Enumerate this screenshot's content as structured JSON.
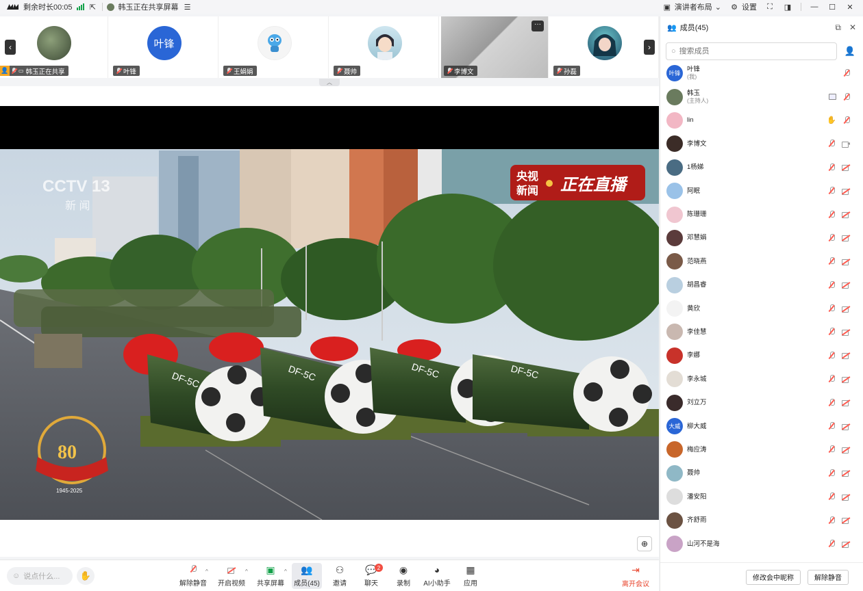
{
  "titlebar": {
    "remaining": "剩余时长00:05",
    "share_status": "韩玉正在共享屏幕",
    "layout_label": "演讲者布局",
    "settings_label": "设置"
  },
  "strip": {
    "tiles": [
      {
        "name": "韩玉正在共享",
        "avatar_color": "#6a7b5e"
      },
      {
        "name": "叶锋",
        "avatar_text": "叶锋",
        "avatar_color": "#2a66d6"
      },
      {
        "name": "王娟娟",
        "avatar_color": "#3aa0e6"
      },
      {
        "name": "聂帅",
        "avatar_color": "#8fb8c6"
      },
      {
        "name": "李博文",
        "avatar_color": "#d9d9d9"
      },
      {
        "name": "孙磊",
        "avatar_color": "#3d7aa0"
      }
    ]
  },
  "toolbar": {
    "chat_placeholder": "说点什么...",
    "unmute": "解除静音",
    "video": "开启视频",
    "share": "共享屏幕",
    "members": "成员(45)",
    "invite": "邀请",
    "chat": "聊天",
    "chat_badge": "2",
    "record": "录制",
    "ai": "AI小助手",
    "apps": "应用",
    "leave": "离开会议"
  },
  "panel": {
    "title": "成员(45)",
    "search_placeholder": "搜索成员",
    "members": [
      {
        "name": "叶锋",
        "sub": "(我)",
        "avatar_text": "叶锋",
        "color": "#2a66d6",
        "icons": [
          "mic"
        ]
      },
      {
        "name": "韩玉",
        "sub": "(主持人)",
        "color": "#6a7b5e",
        "icons": [
          "screen",
          "mic"
        ]
      },
      {
        "name": "lin",
        "sub": "",
        "color": "#f2b7c4",
        "icons": [
          "hand",
          "mic"
        ]
      },
      {
        "name": "李博文",
        "sub": "",
        "color": "#3b2c27",
        "icons": [
          "mic",
          "cam-on"
        ]
      },
      {
        "name": "1杨娣",
        "sub": "",
        "color": "#4a6c83",
        "icons": [
          "mic",
          "cam"
        ]
      },
      {
        "name": "阿眠",
        "sub": "",
        "color": "#9ac2e8",
        "icons": [
          "mic",
          "cam"
        ]
      },
      {
        "name": "陈珊珊",
        "sub": "",
        "color": "#f0c6d0",
        "icons": [
          "mic",
          "cam"
        ]
      },
      {
        "name": "邓慧娟",
        "sub": "",
        "color": "#5b3b3b",
        "icons": [
          "mic",
          "cam"
        ]
      },
      {
        "name": "范晓燕",
        "sub": "",
        "color": "#7a5a48",
        "icons": [
          "mic",
          "cam"
        ]
      },
      {
        "name": "胡昌睿",
        "sub": "",
        "color": "#b9cfe0",
        "icons": [
          "mic",
          "cam"
        ]
      },
      {
        "name": "黄欣",
        "sub": "",
        "color": "#f3f3f3",
        "icons": [
          "mic",
          "cam"
        ]
      },
      {
        "name": "李佳慧",
        "sub": "",
        "color": "#c9b8b0",
        "icons": [
          "mic",
          "cam"
        ]
      },
      {
        "name": "李娜",
        "sub": "",
        "color": "#c8322a",
        "icons": [
          "mic",
          "cam"
        ]
      },
      {
        "name": "李永城",
        "sub": "",
        "color": "#e3ddd5",
        "icons": [
          "mic",
          "cam"
        ]
      },
      {
        "name": "刘立万",
        "sub": "",
        "color": "#3a2b2b",
        "icons": [
          "mic",
          "cam"
        ]
      },
      {
        "name": "柳大威",
        "sub": "",
        "avatar_text": "大威",
        "color": "#2a66d6",
        "icons": [
          "mic",
          "cam"
        ]
      },
      {
        "name": "梅应涛",
        "sub": "",
        "color": "#c8662a",
        "icons": [
          "mic",
          "cam"
        ]
      },
      {
        "name": "聂帅",
        "sub": "",
        "color": "#8fb8c6",
        "icons": [
          "mic",
          "cam"
        ]
      },
      {
        "name": "潘安阳",
        "sub": "",
        "color": "#ddd",
        "icons": [
          "mic",
          "cam"
        ]
      },
      {
        "name": "齐舒雨",
        "sub": "",
        "color": "#6b5242",
        "icons": [
          "mic",
          "cam"
        ]
      },
      {
        "name": "山河不是海",
        "sub": "",
        "color": "#c9a3c6",
        "icons": [
          "mic",
          "cam"
        ]
      }
    ],
    "rename_btn": "修改会中昵称",
    "unmute_btn": "解除静音"
  },
  "video": {
    "channel_logo": "CCTV 13",
    "channel_sub": "新 闻",
    "live_badge_left_1": "央视",
    "live_badge_left_2": "新闻",
    "live_badge_right": "正在直播",
    "anniv_number": "80",
    "anniv_years": "1945-2025",
    "missile_label": "DF-5C"
  }
}
